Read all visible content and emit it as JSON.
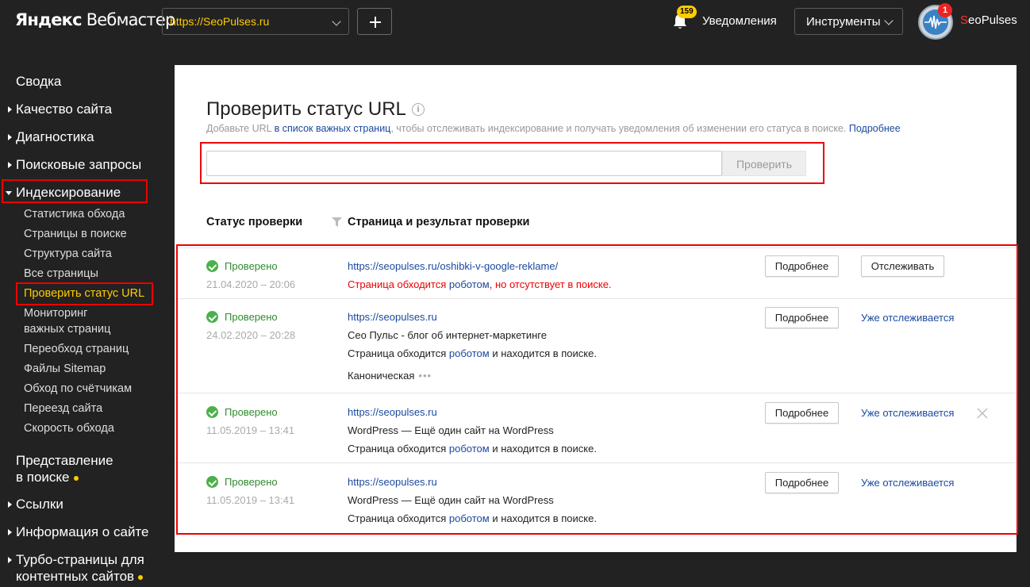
{
  "header": {
    "logo_brand": "Яндекс",
    "logo_product": "Вебмастер",
    "site_selected": "https://SeoPulses.ru",
    "notifications_count": "159",
    "notifications_label": "Уведомления",
    "tools_label": "Инструменты",
    "avatar_badge": "1",
    "username_first": "S",
    "username_rest": "eoPulses"
  },
  "sidebar": {
    "summary": "Сводка",
    "quality": "Качество сайта",
    "diagnostics": "Диагностика",
    "search_queries": "Поисковые запросы",
    "indexing": "Индексирование",
    "indexing_items": [
      "Статистика обхода",
      "Страницы в поиске",
      "Структура сайта",
      "Все страницы",
      "Проверить статус URL",
      "Мониторинг",
      "важных страниц",
      "Переобход страниц",
      "Файлы Sitemap",
      "Обход по счётчикам",
      "Переезд сайта",
      "Скорость обхода"
    ],
    "presentation_line1": "Представление",
    "presentation_line2": "в поиске",
    "links": "Ссылки",
    "site_info": "Информация о сайте",
    "turbo_line1": "Турбо-страницы для",
    "turbo_line2": "контентных сайтов"
  },
  "main": {
    "title": "Проверить статус URL",
    "info_icon": "i",
    "desc_part1": "Добавьте URL ",
    "desc_link1": "в список важных страниц",
    "desc_part2": ", чтобы отслеживать индексирование и получать уведомления об изменении его статуса в поиске. ",
    "desc_link2": "Подробнее",
    "input_value": "",
    "input_placeholder": "",
    "check_button": "Проверить",
    "col_status": "Статус проверки",
    "col_page": "Страница и результат проверки",
    "rows": [
      {
        "status": "Проверено",
        "date": "21.04.2020 – 20:06",
        "url": "https://seopulses.ru/oshibki-v-google-reklame/",
        "result_a": "Страница обходится ",
        "result_robot": "роботом",
        "result_b": ", но отсутствует в поиске.",
        "details": "Подробнее",
        "track": "Отслеживать"
      },
      {
        "status": "Проверено",
        "date": "24.02.2020 – 20:28",
        "url": "https://seopulses.ru",
        "title": "Сео Пульс - блог об интернет-маркетинге",
        "result_a": "Страница обходится ",
        "result_robot": "роботом",
        "result_b": " и находится в поиске.",
        "canonical": "Каноническая",
        "more": "•••",
        "details": "Подробнее",
        "tracked": "Уже отслеживается"
      },
      {
        "status": "Проверено",
        "date": "11.05.2019 – 13:41",
        "url": "https://seopulses.ru",
        "title": "WordPress — Ещё один сайт на WordPress",
        "result_a": "Страница обходится ",
        "result_robot": "роботом",
        "result_b": " и находится в поиске.",
        "details": "Подробнее",
        "tracked": "Уже отслеживается"
      },
      {
        "status": "Проверено",
        "date": "11.05.2019 – 13:41",
        "url": "https://seopulses.ru",
        "title": "WordPress — Ещё один сайт на WordPress",
        "result_a": "Страница обходится ",
        "result_robot": "роботом",
        "result_b": " и находится в поиске.",
        "details": "Подробнее",
        "tracked": "Уже отслеживается"
      }
    ]
  },
  "colors": {
    "background": "#222222",
    "accent_yellow": "#ffcc00",
    "highlight_red": "#ee0000",
    "link_blue": "#1a4aa0",
    "status_green": "#4cb04c"
  },
  "icons": [
    "chevron-down-icon",
    "plus-icon",
    "bell-icon",
    "info-icon",
    "filter-icon",
    "check-circle-icon",
    "close-icon",
    "more-dots-icon"
  ]
}
